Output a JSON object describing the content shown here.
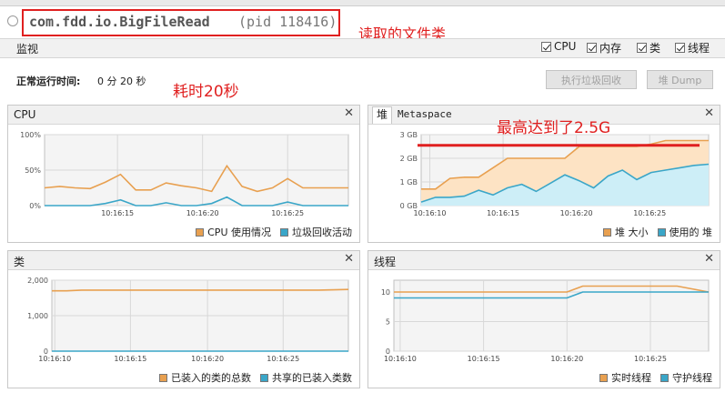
{
  "app": {
    "class_name": "com.fdd.io.BigFileRead",
    "pid": "(pid 118416)"
  },
  "annotations": {
    "file_class": "读取的文件类",
    "elapsed": "耗时20秒",
    "peak": "最高达到了2.5G"
  },
  "monitor": {
    "label": "监视",
    "checkboxes": [
      {
        "label": "CPU",
        "checked": true
      },
      {
        "label": "内存",
        "checked": true
      },
      {
        "label": "类",
        "checked": true
      },
      {
        "label": "线程",
        "checked": true
      }
    ],
    "uptime_label": "正常运行时间:",
    "uptime_value": "0 分 20 秒",
    "buttons": {
      "gc": "执行垃圾回收",
      "heap_dump": "堆 Dump"
    }
  },
  "colors": {
    "orange": "#e8a050",
    "blue": "#3aa6c8",
    "orange_fill": "#fde3c4",
    "blue_fill": "#cdeef7",
    "red": "#e02020",
    "grid": "#d8d8d8",
    "plot_bg": "#f4f4f4"
  },
  "panels": {
    "cpu": {
      "title": "CPU",
      "close": "✕"
    },
    "heap": {
      "tab_heap": "堆",
      "tab_metaspace": "Metaspace",
      "close": "✕"
    },
    "classes": {
      "title": "类",
      "close": "✕"
    },
    "threads": {
      "title": "线程",
      "close": "✕"
    }
  },
  "chart_data": [
    {
      "id": "cpu",
      "type": "line",
      "x_ticks": [
        "10:16:15",
        "10:16:20",
        "10:16:25"
      ],
      "y_ticks": [
        "100%",
        "50%",
        "0%"
      ],
      "ylim": [
        0,
        100
      ],
      "y_tick_values": [
        100,
        50,
        0
      ],
      "x": [
        0,
        1,
        2,
        3,
        4,
        5,
        6,
        7,
        8,
        9,
        10,
        11,
        12,
        13,
        14,
        15,
        16,
        17,
        18,
        19,
        20
      ],
      "series": [
        {
          "name": "CPU 使用情况",
          "color": "#e8a050",
          "values": [
            25,
            27,
            25,
            24,
            33,
            44,
            22,
            22,
            32,
            28,
            25,
            20,
            56,
            27,
            20,
            25,
            38,
            25,
            25,
            25,
            25
          ]
        },
        {
          "name": "垃圾回收活动",
          "color": "#3aa6c8",
          "values": [
            0,
            0,
            0,
            0,
            3,
            8,
            0,
            0,
            4,
            0,
            0,
            3,
            12,
            0,
            0,
            0,
            5,
            0,
            0,
            0,
            0
          ]
        }
      ],
      "grid": true,
      "legend": "bottom-right"
    },
    {
      "id": "heap",
      "type": "area",
      "x_ticks": [
        "10:16:10",
        "10:16:15",
        "10:16:20",
        "10:16:25"
      ],
      "y_ticks": [
        "3 GB",
        "2 GB",
        "1 GB",
        "0 GB"
      ],
      "ylim": [
        0,
        3
      ],
      "y_tick_values": [
        3,
        2,
        1,
        0
      ],
      "x": [
        0,
        1,
        2,
        3,
        4,
        5,
        6,
        7,
        8,
        9,
        10,
        11,
        12,
        13,
        14,
        15,
        16,
        17,
        18,
        19,
        20
      ],
      "series": [
        {
          "name": "堆 大小",
          "color": "#e8a050",
          "values": [
            0.7,
            0.7,
            1.15,
            1.2,
            1.2,
            1.6,
            2.0,
            2.0,
            2.0,
            2.0,
            2.0,
            2.5,
            2.5,
            2.5,
            2.5,
            2.5,
            2.6,
            2.75,
            2.75,
            2.75,
            2.75
          ]
        },
        {
          "name": "使用的 堆",
          "color": "#3aa6c8",
          "values": [
            0.15,
            0.35,
            0.35,
            0.4,
            0.65,
            0.45,
            0.75,
            0.9,
            0.6,
            0.95,
            1.3,
            1.05,
            0.75,
            1.25,
            1.5,
            1.1,
            1.4,
            1.5,
            1.6,
            1.7,
            1.75
          ]
        }
      ],
      "peak_line": {
        "value": 2.55,
        "color": "#e02020"
      },
      "grid": true,
      "legend": "bottom-right"
    },
    {
      "id": "classes",
      "type": "line",
      "x_ticks": [
        "10:16:10",
        "10:16:15",
        "10:16:20",
        "10:16:25"
      ],
      "y_ticks": [
        "2,000",
        "1,000",
        "0"
      ],
      "ylim": [
        0,
        2000
      ],
      "y_tick_values": [
        2000,
        1000,
        0
      ],
      "x": [
        0,
        1,
        2,
        3,
        4,
        5,
        6,
        7,
        8,
        9,
        10,
        11,
        12,
        13,
        14,
        15,
        16,
        17,
        18,
        19,
        20
      ],
      "series": [
        {
          "name": "已装入的类的总数",
          "color": "#e8a050",
          "values": [
            1700,
            1700,
            1720,
            1720,
            1720,
            1720,
            1720,
            1720,
            1720,
            1720,
            1720,
            1720,
            1720,
            1720,
            1720,
            1720,
            1720,
            1720,
            1720,
            1730,
            1740
          ]
        },
        {
          "name": "共享的已装入类数",
          "color": "#3aa6c8",
          "values": [
            0,
            0,
            0,
            0,
            0,
            0,
            0,
            0,
            0,
            0,
            0,
            0,
            0,
            0,
            0,
            0,
            0,
            0,
            0,
            0,
            0
          ]
        }
      ],
      "grid": true,
      "legend": "bottom-right"
    },
    {
      "id": "threads",
      "type": "line",
      "x_ticks": [
        "10:16:10",
        "10:16:15",
        "10:16:20",
        "10:16:25"
      ],
      "y_ticks": [
        "10",
        "5",
        "0"
      ],
      "ylim": [
        0,
        12
      ],
      "y_tick_values": [
        10,
        5,
        0
      ],
      "x": [
        0,
        1,
        2,
        3,
        4,
        5,
        6,
        7,
        8,
        9,
        10,
        11,
        12,
        13,
        14,
        15,
        16,
        17,
        18,
        19,
        20
      ],
      "series": [
        {
          "name": "实时线程",
          "color": "#e8a050",
          "values": [
            10,
            10,
            10,
            10,
            10,
            10,
            10,
            10,
            10,
            10,
            10,
            10,
            11,
            11,
            11,
            11,
            11,
            11,
            11,
            10.5,
            10
          ]
        },
        {
          "name": "守护线程",
          "color": "#3aa6c8",
          "values": [
            9,
            9,
            9,
            9,
            9,
            9,
            9,
            9,
            9,
            9,
            9,
            9,
            10,
            10,
            10,
            10,
            10,
            10,
            10,
            10,
            10
          ]
        }
      ],
      "grid": true,
      "legend": "bottom-right"
    }
  ]
}
